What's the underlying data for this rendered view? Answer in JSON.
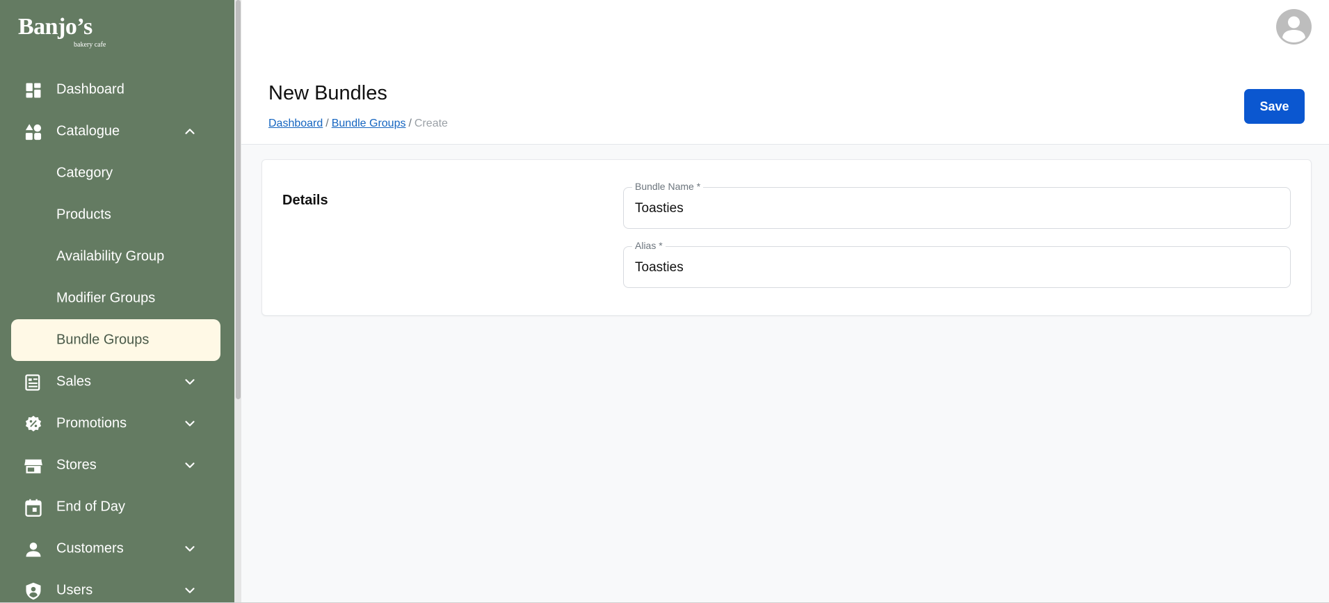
{
  "brand": {
    "name": "Banjo’s",
    "tagline": "bakery cafe"
  },
  "sidebar": {
    "items": [
      {
        "label": "Dashboard",
        "icon": "dashboard-icon"
      },
      {
        "label": "Catalogue",
        "icon": "category-shapes-icon",
        "expanded": true
      },
      {
        "label": "Category"
      },
      {
        "label": "Products"
      },
      {
        "label": "Availability Group"
      },
      {
        "label": "Modifier Groups"
      },
      {
        "label": "Bundle Groups",
        "active": true
      },
      {
        "label": "Sales",
        "icon": "receipt-icon"
      },
      {
        "label": "Promotions",
        "icon": "discount-badge-icon"
      },
      {
        "label": "Stores",
        "icon": "storefront-icon"
      },
      {
        "label": "End of Day",
        "icon": "calendar-icon"
      },
      {
        "label": "Customers",
        "icon": "person-icon"
      },
      {
        "label": "Users",
        "icon": "shield-user-icon"
      }
    ]
  },
  "header": {
    "title": "New Bundles",
    "breadcrumb": {
      "dashboard": "Dashboard",
      "bundle_groups": "Bundle Groups",
      "current": "Create",
      "separator": "/"
    },
    "save_label": "Save"
  },
  "form": {
    "section_title": "Details",
    "bundle_name": {
      "label": "Bundle Name *",
      "value": "Toasties"
    },
    "alias": {
      "label": "Alias *",
      "value": "Toasties"
    }
  },
  "colors": {
    "sidebar": "#647b62",
    "active_item": "#fff9e6",
    "primary": "#0b57d0",
    "link": "#1565c0"
  }
}
